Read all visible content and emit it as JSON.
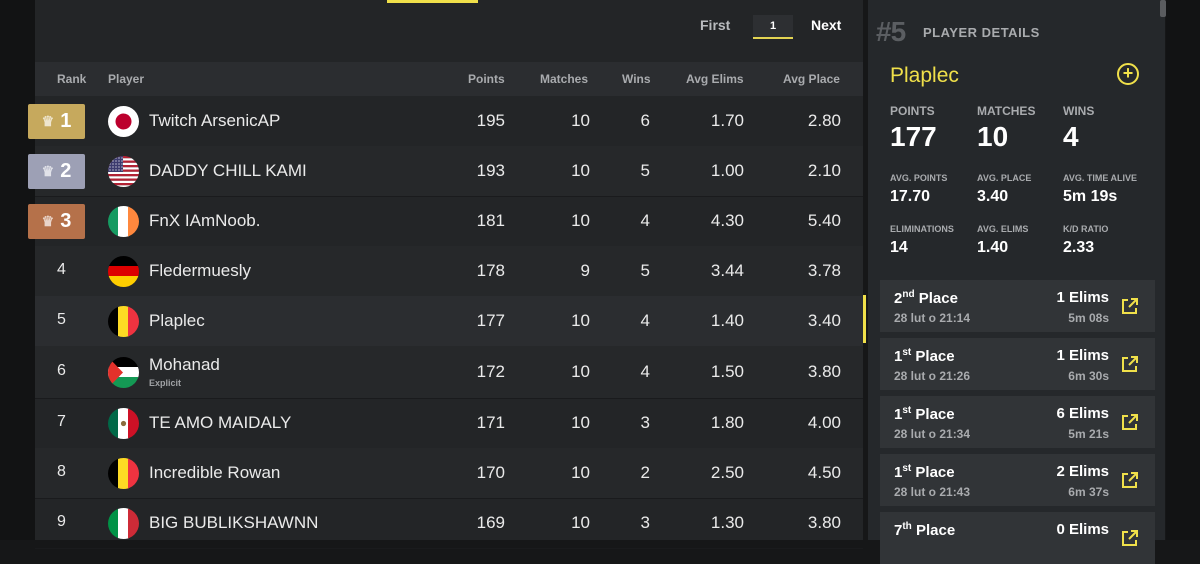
{
  "pagination": {
    "first": "First",
    "page": "1",
    "next": "Next"
  },
  "columns": {
    "rank": "Rank",
    "player": "Player",
    "points": "Points",
    "matches": "Matches",
    "wins": "Wins",
    "avg_elims": "Avg Elims",
    "avg_place": "Avg Place"
  },
  "rows": [
    {
      "rank": "1",
      "player": "Twitch ArsenicAP",
      "points": "195",
      "matches": "10",
      "wins": "6",
      "avg_elims": "1.70",
      "avg_place": "2.80",
      "badge_color": "#c6a95d",
      "flag": "japan"
    },
    {
      "rank": "2",
      "player": "DADDY CHILL KAMI",
      "points": "193",
      "matches": "10",
      "wins": "5",
      "avg_elims": "1.00",
      "avg_place": "2.10",
      "badge_color": "#9da0b5",
      "flag": "usa"
    },
    {
      "rank": "3",
      "player": "FnX IAmNoob.",
      "points": "181",
      "matches": "10",
      "wins": "4",
      "avg_elims": "4.30",
      "avg_place": "5.40",
      "badge_color": "#b5714a",
      "flag": "ireland"
    },
    {
      "rank": "4",
      "player": "Fledermuesly",
      "points": "178",
      "matches": "9",
      "wins": "5",
      "avg_elims": "3.44",
      "avg_place": "3.78",
      "flag": "germany"
    },
    {
      "rank": "5",
      "player": "Plaplec",
      "points": "177",
      "matches": "10",
      "wins": "4",
      "avg_elims": "1.40",
      "avg_place": "3.40",
      "flag": "belgium"
    },
    {
      "rank": "6",
      "player": "Mohanad",
      "sub": "Explicit",
      "points": "172",
      "matches": "10",
      "wins": "4",
      "avg_elims": "1.50",
      "avg_place": "3.80",
      "flag": "palestine"
    },
    {
      "rank": "7",
      "player": "TE AMO MAIDALY",
      "points": "171",
      "matches": "10",
      "wins": "3",
      "avg_elims": "1.80",
      "avg_place": "4.00",
      "flag": "mexico"
    },
    {
      "rank": "8",
      "player": "Incredible Rowan",
      "points": "170",
      "matches": "10",
      "wins": "2",
      "avg_elims": "2.50",
      "avg_place": "4.50",
      "flag": "belgium"
    },
    {
      "rank": "9",
      "player": "BIG BUBLIKSHAWNN",
      "points": "169",
      "matches": "10",
      "wins": "3",
      "avg_elims": "1.30",
      "avg_place": "3.80",
      "flag": "italy"
    }
  ],
  "details": {
    "rank": "#5",
    "title": "PLAYER DETAILS",
    "name": "Plaplec",
    "add_icon": "plus-circle-icon",
    "stats_big": [
      {
        "label": "POINTS",
        "value": "177"
      },
      {
        "label": "MATCHES",
        "value": "10"
      },
      {
        "label": "WINS",
        "value": "4"
      }
    ],
    "stats_small": [
      {
        "label": "AVG. POINTS",
        "value": "17.70"
      },
      {
        "label": "AVG. PLACE",
        "value": "3.40"
      },
      {
        "label": "AVG. TIME ALIVE",
        "value": "5m 19s"
      },
      {
        "label": "ELIMINATIONS",
        "value": "14"
      },
      {
        "label": "AVG. ELIMS",
        "value": "1.40"
      },
      {
        "label": "K/D RATIO",
        "value": "2.33"
      }
    ],
    "matches": [
      {
        "place_num": "2",
        "place_suffix": "nd",
        "place_word": "Place",
        "date": "28 lut o 21:14",
        "elims": "1 Elims",
        "time": "5m 08s"
      },
      {
        "place_num": "1",
        "place_suffix": "st",
        "place_word": "Place",
        "date": "28 lut o 21:26",
        "elims": "1 Elims",
        "time": "6m 30s"
      },
      {
        "place_num": "1",
        "place_suffix": "st",
        "place_word": "Place",
        "date": "28 lut o 21:34",
        "elims": "6 Elims",
        "time": "5m 21s"
      },
      {
        "place_num": "1",
        "place_suffix": "st",
        "place_word": "Place",
        "date": "28 lut o 21:43",
        "elims": "2 Elims",
        "time": "6m 37s"
      },
      {
        "place_num": "7",
        "place_suffix": "th",
        "place_word": "Place",
        "date": "",
        "elims": "0 Elims",
        "time": ""
      }
    ]
  },
  "colors": {
    "accent": "#f0e04a",
    "background": "#232527",
    "panel": "#25282b"
  }
}
